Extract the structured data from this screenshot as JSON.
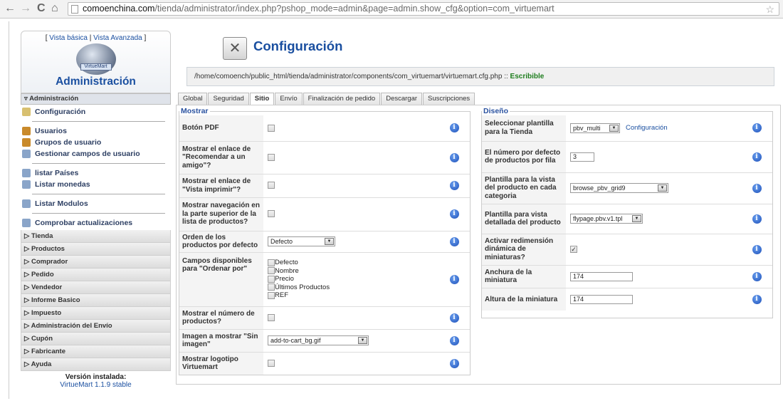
{
  "browser": {
    "url_domain": "comoenchina.com",
    "url_path": "/tienda/administrator/index.php?pshop_mode=admin&page=admin.show_cfg&option=com_virtuemart",
    "back": "←",
    "forward": "→",
    "reload": "C",
    "home": "⌂",
    "star": "☆"
  },
  "sidebar": {
    "view_open": "[ ",
    "view_basic": "Vista básica",
    "view_sep": " | ",
    "view_advanced": "Vista Avanzada",
    "view_close": " ]",
    "logo_text": "VirtueMart",
    "title": "Administración",
    "section_open": "Administración",
    "items": [
      {
        "label": "Configuración",
        "icon": "tools-icon",
        "color": "#d8c070"
      },
      {
        "label": "Usuarios",
        "icon": "users-icon",
        "color": "#c98a2b"
      },
      {
        "label": "Grupos de usuario",
        "icon": "users-icon",
        "color": "#c98a2b"
      },
      {
        "label": "Gestionar campos de usuario",
        "icon": "document-icon",
        "color": "#8aa5c9"
      },
      {
        "label": "listar Países",
        "icon": "document-icon",
        "color": "#8aa5c9"
      },
      {
        "label": "Listar monedas",
        "icon": "document-icon",
        "color": "#8aa5c9"
      },
      {
        "label": "Listar Modulos",
        "icon": "document-icon",
        "color": "#8aa5c9"
      },
      {
        "label": "Comprobar actualizaciones",
        "icon": "document-icon",
        "color": "#8aa5c9"
      }
    ],
    "collapsed": [
      "Tienda",
      "Productos",
      "Comprador",
      "Pedido",
      "Vendedor",
      "Informe Basico",
      "Impuesto",
      "Administración del Envío",
      "Cupón",
      "Fabricante",
      "Ayuda"
    ],
    "version_label": "Versión instalada:",
    "version_value": "VirtueMart 1.1.9 stable"
  },
  "header": {
    "title": "Configuración",
    "path": "/home/comoench/public_html/tienda/administrator/components/com_virtuemart/virtuemart.cfg.php",
    "path_sep": " :: ",
    "status": "Escribible"
  },
  "tabs": [
    "Global",
    "Seguridad",
    "Sitio",
    "Envío",
    "Finalización de pedido",
    "Descargar",
    "Suscripciones"
  ],
  "active_tab": "Sitio",
  "mostrar": {
    "legend": "Mostrar",
    "pdf": "Botón PDF",
    "recomendar": "Mostrar el enlace de \"Recomendar a un amigo\"?",
    "imprimir": "Mostrar el enlace de \"Vista imprimir\"?",
    "navegacion": "Mostrar navegación en la parte superior de la lista de productos?",
    "orden": "Orden de los productos por defecto",
    "orden_value": "Defecto",
    "campos": "Campos disponibles para \"Ordenar por\"",
    "campos_opts": [
      "Defecto",
      "Nombre",
      "Precio",
      "Últimos Productos",
      "REF"
    ],
    "numero": "Mostrar el número de productos?",
    "imagen": "Imagen a mostrar \"Sin imagen\"",
    "imagen_value": "add-to-cart_bg.gif",
    "logotipo": "Mostrar logotipo Virtuemart"
  },
  "diseno": {
    "legend": "Diseño",
    "plantilla": "Seleccionar plantilla para la Tienda",
    "plantilla_value": "pbv_multi",
    "plantilla_link": "Configuración",
    "numero": "El número por defecto de productos por fila",
    "numero_value": "3",
    "vista_cat": "Plantilla para la vista del producto en cada categoria",
    "vista_cat_value": "browse_pbv_grid9",
    "vista_det": "Plantilla para vista detallada del producto",
    "vista_det_value": "flypage.pbv.v1.tpl",
    "redim": "Activar redimensión dinámica de miniaturas?",
    "anchura": "Anchura de la miniatura",
    "anchura_value": "174",
    "altura": "Altura de la miniatura",
    "altura_value": "174"
  },
  "info_glyph": "i",
  "select_arrow": "▼",
  "check_glyph": "✓"
}
